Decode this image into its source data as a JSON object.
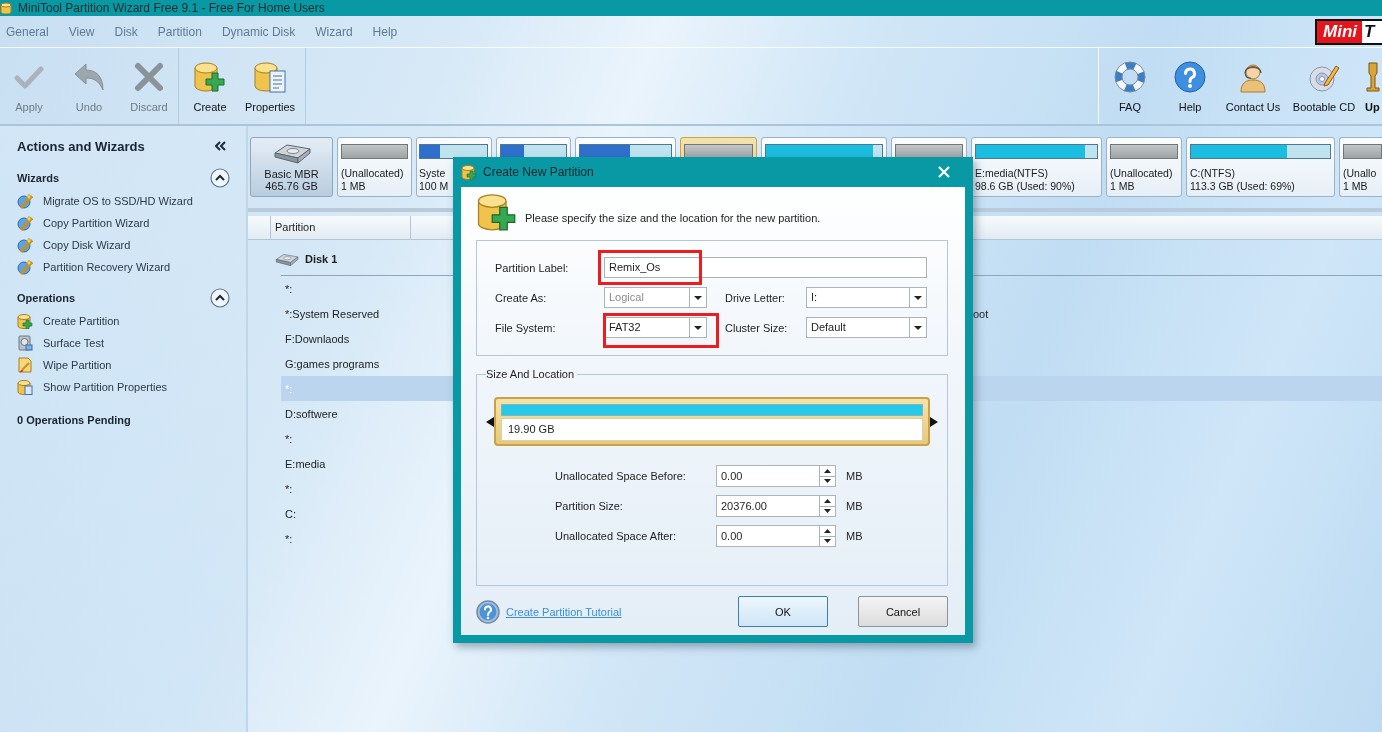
{
  "window": {
    "title": "MiniTool Partition Wizard Free 9.1 - Free For Home Users"
  },
  "menu": [
    "General",
    "View",
    "Disk",
    "Partition",
    "Dynamic Disk",
    "Wizard",
    "Help"
  ],
  "logo": [
    "Mini",
    "T"
  ],
  "toolbar": {
    "groups": [
      {
        "items": [
          {
            "label": "Apply",
            "kind": "apply",
            "disabled": true
          },
          {
            "label": "Undo",
            "kind": "undo",
            "disabled": true
          },
          {
            "label": "Discard",
            "kind": "discard",
            "disabled": true
          }
        ]
      },
      {
        "items": [
          {
            "label": "Create",
            "kind": "create",
            "disabled": false
          },
          {
            "label": "Properties",
            "kind": "properties",
            "disabled": false
          }
        ]
      },
      {
        "items": [
          {
            "label": "FAQ",
            "kind": "faq",
            "disabled": false
          },
          {
            "label": "Help",
            "kind": "help",
            "disabled": false
          },
          {
            "label": "Contact Us",
            "kind": "contact",
            "disabled": false
          },
          {
            "label": "Bootable CD",
            "kind": "bootable_cd",
            "disabled": false
          },
          {
            "label": "Up",
            "kind": "upgrade",
            "disabled": false
          }
        ]
      }
    ]
  },
  "sidebar": {
    "title": "Actions and Wizards",
    "sections": [
      {
        "title": "Wizards",
        "expanded": true,
        "items": [
          {
            "label": "Migrate OS to SSD/HD Wizard",
            "kind": "wizard"
          },
          {
            "label": "Copy Partition Wizard",
            "kind": "wizard"
          },
          {
            "label": "Copy Disk Wizard",
            "kind": "wizard"
          },
          {
            "label": "Partition Recovery Wizard",
            "kind": "wizard"
          }
        ]
      },
      {
        "title": "Operations",
        "expanded": true,
        "items": [
          {
            "label": "Create Partition",
            "kind": "create"
          },
          {
            "label": "Surface Test",
            "kind": "surface_test"
          },
          {
            "label": "Wipe Partition",
            "kind": "wipe"
          },
          {
            "label": "Show Partition Properties",
            "kind": "properties"
          }
        ]
      }
    ],
    "pending": "0 Operations Pending"
  },
  "disk_map": {
    "disk": {
      "type": "Basic MBR",
      "size": "465.76 GB"
    },
    "partitions": [
      {
        "kind": "unallocated",
        "label": "(Unallocated)",
        "size": "1 MB",
        "selected": false
      },
      {
        "kind": "partition",
        "label": "Syste",
        "size": "100 M",
        "color": "#2f6fcc",
        "level": 0.3,
        "selected": false
      },
      {
        "kind": "partition",
        "color": "#2f6fcc",
        "level": 0.35,
        "selected": false
      },
      {
        "kind": "partition",
        "color": "#2f6fcc",
        "level": 0.55,
        "selected": false
      },
      {
        "kind": "unallocated",
        "selected": true
      },
      {
        "kind": "partition",
        "color": "#1bbde0",
        "level": 0.92,
        "selected": false
      },
      {
        "kind": "unallocated",
        "selected": false
      },
      {
        "kind": "partition",
        "label": "E:media(NTFS)",
        "size": "98.6 GB (Used: 90%)",
        "color": "#1bbde0",
        "level": 0.9,
        "selected": false
      },
      {
        "kind": "unallocated",
        "label": "(Unallocated)",
        "size": "1 MB",
        "selected": false
      },
      {
        "kind": "partition",
        "label": "C:(NTFS)",
        "size": "113.3 GB (Used: 69%)",
        "color": "#1bbde0",
        "level": 0.69,
        "selected": false
      },
      {
        "kind": "unallocated",
        "label": "(Unallo",
        "size": "1 MB",
        "selected": false
      }
    ]
  },
  "partition_list": {
    "columns": [
      "Partition"
    ],
    "disk": "Disk 1",
    "rows": [
      {
        "partition": "*:",
        "selected": false
      },
      {
        "partition": "*:System Reserved",
        "column_2": "oot",
        "selected": false
      },
      {
        "partition": "F:Downlaods",
        "selected": false
      },
      {
        "partition": "G:games programs",
        "selected": false
      },
      {
        "partition": "*:",
        "selected": true
      },
      {
        "partition": "D:softwere",
        "selected": false
      },
      {
        "partition": "*:",
        "selected": false
      },
      {
        "partition": "E:media",
        "selected": false
      },
      {
        "partition": "*:",
        "selected": false
      },
      {
        "partition": "C:",
        "selected": false
      },
      {
        "partition": "*:",
        "selected": false
      }
    ]
  },
  "dialog": {
    "title": "Create New Partition",
    "message": "Please specify the size and the location for the new partition.",
    "fields": [
      {
        "label": "Partition Label:",
        "kind": "text",
        "value": "Remix_Os",
        "disabled": false,
        "highlighted": true
      },
      {
        "label": "Create As:",
        "kind": "dropdown",
        "value": "Logical",
        "disabled": true,
        "highlighted": false
      },
      {
        "label": "Drive Letter:",
        "kind": "dropdown",
        "value": "I:",
        "disabled": false,
        "highlighted": false
      },
      {
        "label": "File System:",
        "kind": "dropdown",
        "value": "FAT32",
        "disabled": false,
        "highlighted": true
      },
      {
        "label": "Cluster Size:",
        "kind": "dropdown",
        "value": "Default",
        "disabled": false,
        "highlighted": false
      }
    ],
    "size_location": {
      "title": "Size And Location",
      "partition_bar": {
        "size": "19.90 GB"
      },
      "spinners": [
        {
          "label": "Unallocated Space Before:",
          "value": "0.00",
          "unit": "MB"
        },
        {
          "label": "Partition Size:",
          "value": "20376.00",
          "unit": "MB"
        },
        {
          "label": "Unallocated Space After:",
          "value": "0.00",
          "unit": "MB"
        }
      ]
    },
    "tutorial_link": "Create Partition Tutorial",
    "buttons": [
      {
        "label": "OK",
        "default": true
      },
      {
        "label": "Cancel",
        "default": false
      }
    ]
  }
}
